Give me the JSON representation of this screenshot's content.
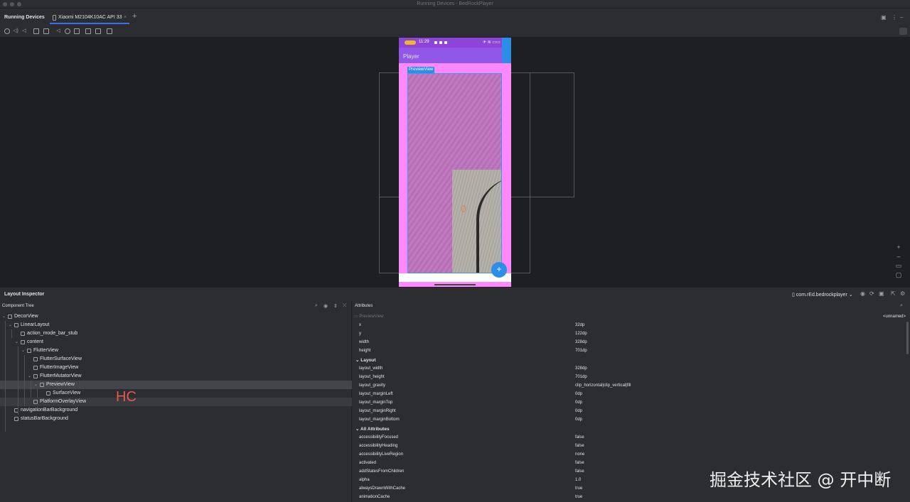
{
  "window": {
    "title": "Running Devices - BedRockPlayer"
  },
  "tabs": {
    "tool_title": "Running Devices",
    "device_tab_label": "Xiaomi M2104K10AC API 33",
    "close_glyph": "×",
    "add_glyph": "+"
  },
  "device": {
    "status_time": "11:29",
    "status_right": "✈ ≋ ▭▭",
    "app_title": "Player",
    "preview_badge": "PreviewView",
    "fab_glyph": "+"
  },
  "inspector": {
    "title": "Layout Inspector",
    "process": "com.rEd.bedrockplayer",
    "component_tree_title": "Component Tree",
    "attributes_title": "Attributes",
    "tree": [
      {
        "name": "DecorView",
        "expanded": true
      },
      {
        "name": "LinearLayout",
        "expanded": true
      },
      {
        "name": "action_mode_bar_stub"
      },
      {
        "name": "content",
        "expanded": true
      },
      {
        "name": "FlutterView",
        "expanded": true
      },
      {
        "name": "FlutterSurfaceView"
      },
      {
        "name": "FlutterImageView"
      },
      {
        "name": "FlutterMutatorView",
        "expanded": true
      },
      {
        "name": "PreviewView",
        "expanded": true,
        "selected": true
      },
      {
        "name": "SurfaceView"
      },
      {
        "name": "PlatformOverlayView"
      },
      {
        "name": "navigationBarBackground"
      },
      {
        "name": "statusBarBackground"
      }
    ],
    "hc_label": "HC",
    "selected_view": "PreviewView",
    "selected_id": "<unnamed>",
    "attrs_top": [
      {
        "k": "x",
        "v": "32dp"
      },
      {
        "k": "y",
        "v": "122dp"
      },
      {
        "k": "width",
        "v": "328dp"
      },
      {
        "k": "height",
        "v": "701dp"
      }
    ],
    "layout_section": "Layout",
    "attrs_layout": [
      {
        "k": "layout_width",
        "v": "328dp"
      },
      {
        "k": "layout_height",
        "v": "701dp"
      },
      {
        "k": "layout_gravity",
        "v": "clip_horizontal|clip_vertical|fill"
      },
      {
        "k": "layout_marginLeft",
        "v": "0dp"
      },
      {
        "k": "layout_marginTop",
        "v": "0dp"
      },
      {
        "k": "layout_marginRight",
        "v": "0dp"
      },
      {
        "k": "layout_marginBottom",
        "v": "0dp"
      }
    ],
    "all_section": "All Attributes",
    "attrs_all": [
      {
        "k": "accessibilityFocused",
        "v": "false"
      },
      {
        "k": "accessibilityHeading",
        "v": "false"
      },
      {
        "k": "accessibilityLiveRegion",
        "v": "none"
      },
      {
        "k": "activated",
        "v": "false"
      },
      {
        "k": "addStatesFromChildren",
        "v": "false"
      },
      {
        "k": "alpha",
        "v": "1.0"
      },
      {
        "k": "alwaysDrawnWithCache",
        "v": "true"
      },
      {
        "k": "animationCache",
        "v": "true"
      }
    ]
  },
  "watermark": "掘金技术社区 @ 开中断",
  "colors": {
    "accent": "#3574f0",
    "selection": "#43454a",
    "hc": "#e8584f",
    "device_accent": "#2b8ee8"
  }
}
